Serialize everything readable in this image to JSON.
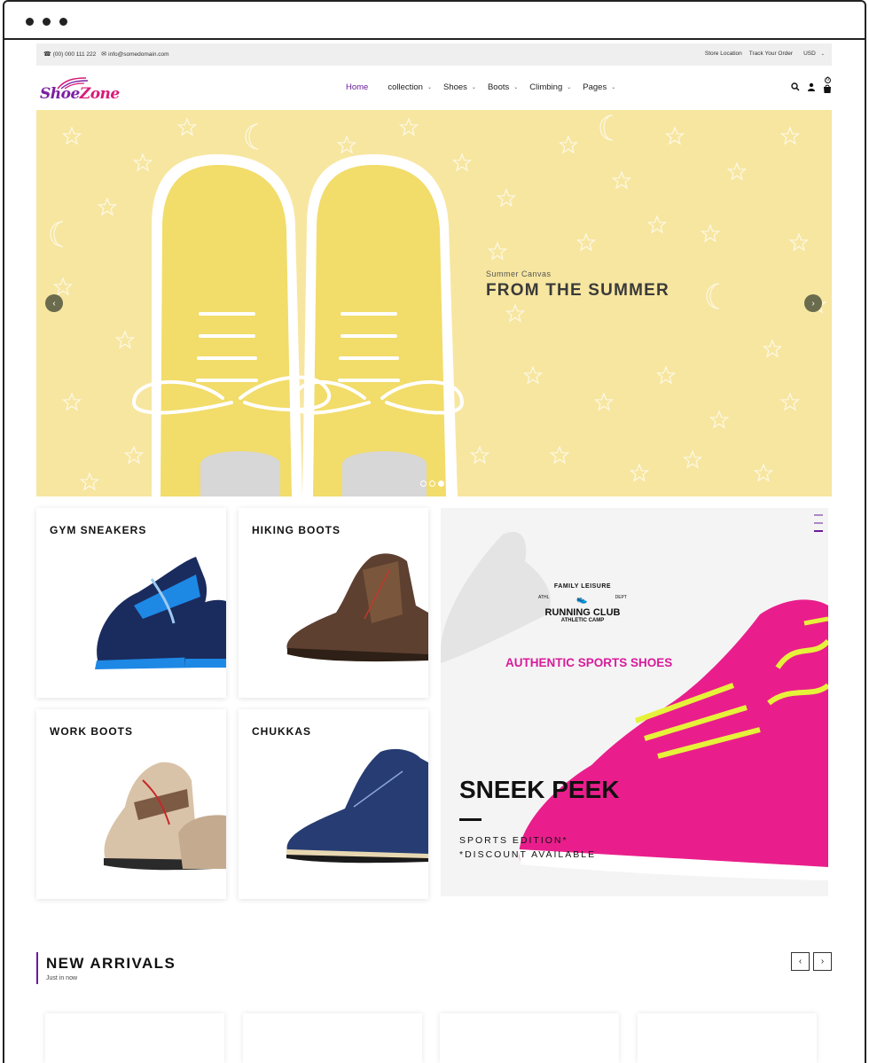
{
  "topbar": {
    "phone": "(00) 000 111 222",
    "email": "info@somedomain.com",
    "store_location": "Store Location",
    "track_order": "Track Your Order",
    "currency": "USD"
  },
  "logo": {
    "part1": "Shoe",
    "part2": "Zone"
  },
  "nav": {
    "home": "Home",
    "collection": "collection",
    "shoes": "Shoes",
    "boots": "Boots",
    "climbing": "Climbing",
    "pages": "Pages"
  },
  "header_icons": [
    "search-icon",
    "user-icon",
    "cart-icon"
  ],
  "cart": {
    "count": "0"
  },
  "hero": {
    "subtitle": "Summer Canvas",
    "title": "FROM THE SUMMER",
    "slides": 3,
    "active_slide": 3,
    "prev": "‹",
    "next": "›"
  },
  "categories": {
    "gym": "GYM SNEAKERS",
    "hiking": "HIKING BOOTS",
    "work": "WORK BOOTS",
    "chukkas": "CHUKKAS"
  },
  "promo": {
    "badge_top": "FAMILY LEISURE",
    "badge_left": "ATHL",
    "badge_right": "DEPT",
    "badge_main": "RUNNING CLUB",
    "badge_sub": "ATHLETIC CAMP",
    "tagline": "AUTHENTIC SPORTS SHOES",
    "title": "SNEEK PEEK",
    "line1": "SPORTS EDITION*",
    "line2": "*DISCOUNT AVAILABLE"
  },
  "new_arrivals": {
    "title": "NEW ARRIVALS",
    "subtitle": "Just in now",
    "prev": "‹",
    "next": "›"
  },
  "colors": {
    "accent": "#6a1b9a",
    "hero_bg": "#f7e6a0",
    "promo_pink": "#d81b9b"
  }
}
